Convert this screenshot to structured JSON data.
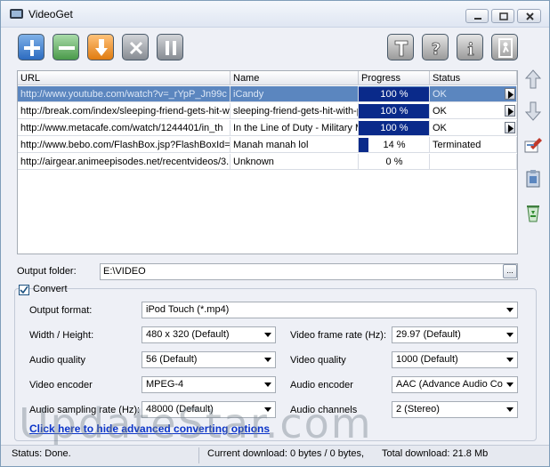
{
  "window": {
    "title": "VideoGet"
  },
  "grid": {
    "columns": [
      "URL",
      "Name",
      "Progress",
      "Status"
    ],
    "rows": [
      {
        "url": "http://www.youtube.com/watch?v=_rYpP_Jn99c",
        "name": "iCandy",
        "progress_text": "100 %",
        "progress": 1.0,
        "status": "OK",
        "selected": true,
        "has_play": true
      },
      {
        "url": "http://break.com/index/sleeping-friend-gets-hit-w",
        "name": "sleeping-friend-gets-hit-with-po",
        "progress_text": "100 %",
        "progress": 1.0,
        "status": "OK",
        "selected": false,
        "has_play": true
      },
      {
        "url": "http://www.metacafe.com/watch/1244401/in_th",
        "name": "In the Line of Duty - Military M",
        "progress_text": "100 %",
        "progress": 1.0,
        "status": "OK",
        "selected": false,
        "has_play": true
      },
      {
        "url": "http://www.bebo.com/FlashBox.jsp?FlashBoxId=",
        "name": "Manah manah lol",
        "progress_text": "14 %",
        "progress": 0.14,
        "status": "Terminated",
        "selected": false,
        "has_play": false
      },
      {
        "url": "http://airgear.animeepisodes.net/recentvideos/3.",
        "name": "Unknown",
        "progress_text": "0 %",
        "progress": 0.0,
        "status": "",
        "selected": false,
        "has_play": false
      }
    ]
  },
  "output": {
    "label": "Output folder:",
    "value": "E:\\VIDEO",
    "browse": "..."
  },
  "convert": {
    "label": "Convert",
    "checked": true,
    "output_format_label": "Output format:",
    "output_format": "iPod Touch (*.mp4)",
    "width_height_label": "Width / Height:",
    "width_height": "480 x 320 (Default)",
    "frame_rate_label": "Video frame rate (Hz):",
    "frame_rate": "29.97 (Default)",
    "audio_quality_label": "Audio quality",
    "audio_quality": "56 (Default)",
    "video_quality_label": "Video quality",
    "video_quality": "1000 (Default)",
    "video_encoder_label": "Video encoder",
    "video_encoder": "MPEG-4",
    "audio_encoder_label": "Audio encoder",
    "audio_encoder": "AAC (Advance Audio Cod",
    "sampling_rate_label": "Audio sampling rate (Hz):",
    "sampling_rate": "48000 (Default)",
    "channels_label": "Audio channels",
    "channels": "2 (Stereo)",
    "hide_link": "Click here to hide advanced converting options"
  },
  "status": {
    "state": "Status: Done.",
    "current": "Current download: 0 bytes / 0 bytes,",
    "total": "Total download: 21.8 Mb"
  },
  "watermark": "UpdateStar.com",
  "colors": {
    "selection": "#5b86bf",
    "progress_fill": "#0a2a8a",
    "link": "#0b34c8"
  }
}
